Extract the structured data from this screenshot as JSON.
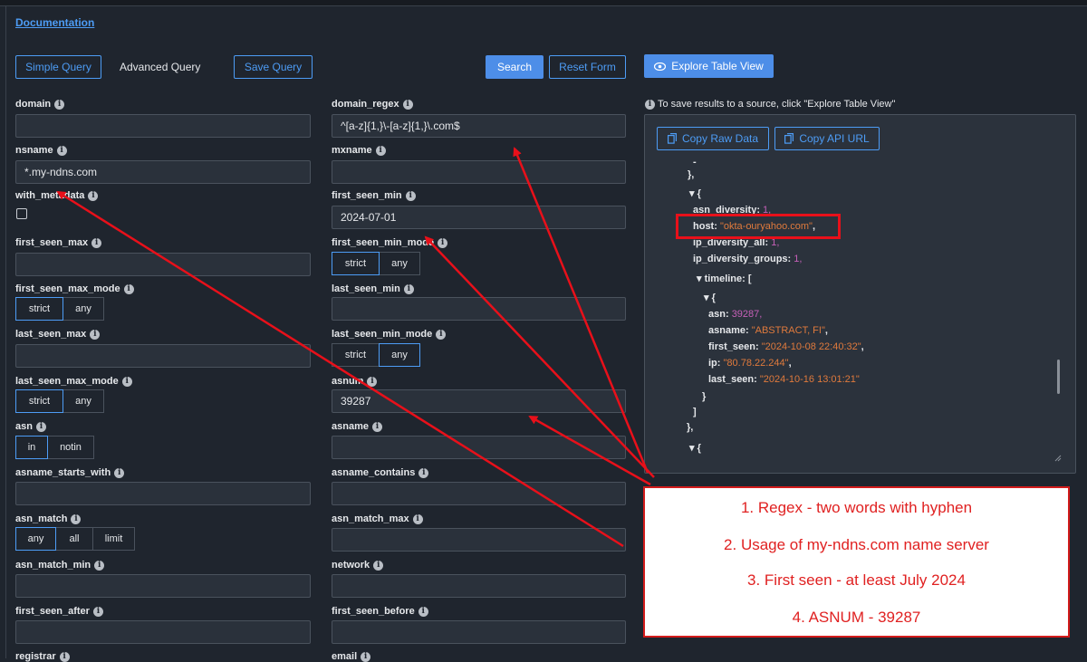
{
  "header": {
    "doc_link": "Documentation"
  },
  "toolbar": {
    "simple_query": "Simple Query",
    "advanced_query": "Advanced Query",
    "save_query": "Save Query",
    "search": "Search",
    "reset_form": "Reset Form",
    "explore_table_view": "Explore Table View"
  },
  "fields": {
    "domain": {
      "label": "domain",
      "value": ""
    },
    "domain_regex": {
      "label": "domain_regex",
      "value": "^[a-z]{1,}\\-[a-z]{1,}\\.com$"
    },
    "nsname": {
      "label": "nsname",
      "value": "*.my-ndns.com"
    },
    "mxname": {
      "label": "mxname",
      "value": ""
    },
    "with_metadata": {
      "label": "with_metadata"
    },
    "first_seen_min": {
      "label": "first_seen_min",
      "value": "2024-07-01"
    },
    "first_seen_max": {
      "label": "first_seen_max",
      "value": ""
    },
    "first_seen_min_mode": {
      "label": "first_seen_min_mode",
      "options": [
        "strict",
        "any"
      ],
      "selected": "strict"
    },
    "first_seen_max_mode": {
      "label": "first_seen_max_mode",
      "options": [
        "strict",
        "any"
      ],
      "selected": "strict"
    },
    "last_seen_min": {
      "label": "last_seen_min",
      "value": ""
    },
    "last_seen_max": {
      "label": "last_seen_max",
      "value": ""
    },
    "last_seen_min_mode": {
      "label": "last_seen_min_mode",
      "options": [
        "strict",
        "any"
      ],
      "selected": "any"
    },
    "last_seen_max_mode": {
      "label": "last_seen_max_mode",
      "options": [
        "strict",
        "any"
      ],
      "selected": "strict"
    },
    "asnum": {
      "label": "asnum",
      "value": "39287"
    },
    "asn": {
      "label": "asn",
      "options": [
        "in",
        "notin"
      ],
      "selected": "in"
    },
    "asname": {
      "label": "asname",
      "value": ""
    },
    "asname_starts_with": {
      "label": "asname_starts_with",
      "value": ""
    },
    "asname_contains": {
      "label": "asname_contains",
      "value": ""
    },
    "asn_match": {
      "label": "asn_match",
      "options": [
        "any",
        "all",
        "limit"
      ],
      "selected": "any"
    },
    "asn_match_max": {
      "label": "asn_match_max",
      "value": ""
    },
    "asn_match_min": {
      "label": "asn_match_min",
      "value": ""
    },
    "network": {
      "label": "network",
      "value": ""
    },
    "first_seen_after": {
      "label": "first_seen_after",
      "value": ""
    },
    "first_seen_before": {
      "label": "first_seen_before",
      "value": ""
    },
    "registrar": {
      "label": "registrar"
    },
    "email": {
      "label": "email"
    }
  },
  "results": {
    "save_note": "To save results to a source, click \"Explore Table View\"",
    "copy_raw_data": "Copy Raw Data",
    "copy_api_url": "Copy API URL",
    "json": {
      "l0": "-",
      "l1": "},",
      "l2": "{",
      "asn_diversity_key": "asn_diversity:",
      "asn_diversity_val": "1,",
      "host_key": "host:",
      "host_val": "\"okta-ouryahoo.com\"",
      "host_comma": ",",
      "ip_diversity_all_key": "ip_diversity_all:",
      "ip_diversity_all_val": "1,",
      "ip_diversity_groups_key": "ip_diversity_groups:",
      "ip_diversity_groups_val": "1,",
      "timeline_key": "timeline: [",
      "brace_open": "{",
      "asn_key": "asn:",
      "asn_val": "39287,",
      "asname_key": "asname:",
      "asname_val": "\"ABSTRACT, FI\"",
      "first_seen_key": "first_seen:",
      "first_seen_val": "\"2024-10-08 22:40:32\"",
      "ip_key": "ip:",
      "ip_val": "\"80.78.22.244\"",
      "last_seen_key": "last_seen:",
      "last_seen_val": "\"2024-10-16 13:01:21\"",
      "brace_close": "}",
      "bracket_close": "]",
      "outer_close": "},",
      "next_open": "{"
    }
  },
  "annotations": {
    "note1": "1. Regex - two words with hyphen",
    "note2": "2. Usage of my-ndns.com name server",
    "note3": "3. First seen - at least July 2024",
    "note4": "4. ASNUM - 39287"
  },
  "colors": {
    "accent": "#4d9cf5",
    "annotation_red": "#e02121",
    "json_string": "#e07a3c",
    "json_number": "#c560b8"
  }
}
